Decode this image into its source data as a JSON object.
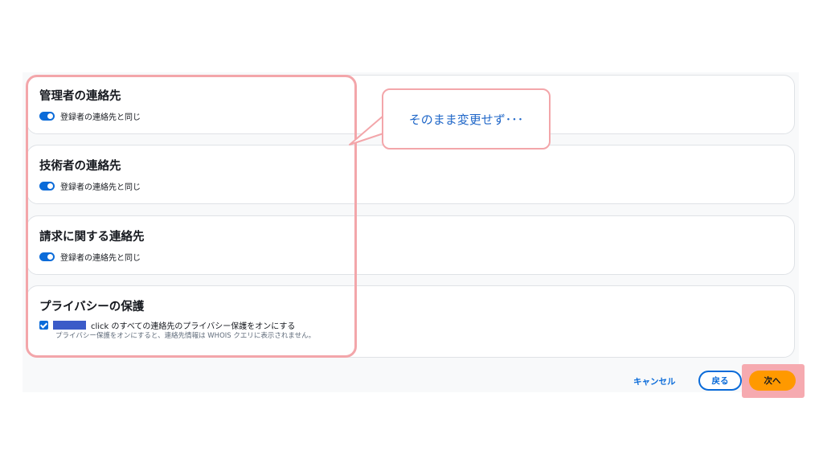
{
  "sections": [
    {
      "title": "管理者の連絡先",
      "toggle_label": "登録者の連絡先と同じ"
    },
    {
      "title": "技術者の連絡先",
      "toggle_label": "登録者の連絡先と同じ"
    },
    {
      "title": "請求に関する連絡先",
      "toggle_label": "登録者の連絡先と同じ"
    }
  ],
  "privacy": {
    "title": "プライバシーの保護",
    "checkbox_label": "click のすべての連絡先のプライバシー保護をオンにする",
    "description": "プライバシー保護をオンにすると、連絡先情報は WHOIS クエリに表示されません。"
  },
  "annotation": {
    "text": "そのまま変更せず･･･"
  },
  "footer": {
    "cancel_label": "キャンセル",
    "back_label": "戻る",
    "next_label": "次へ"
  },
  "colors": {
    "primary": "#0a6bd9",
    "accent": "#ff9900",
    "highlight": "#f3a6aa"
  }
}
